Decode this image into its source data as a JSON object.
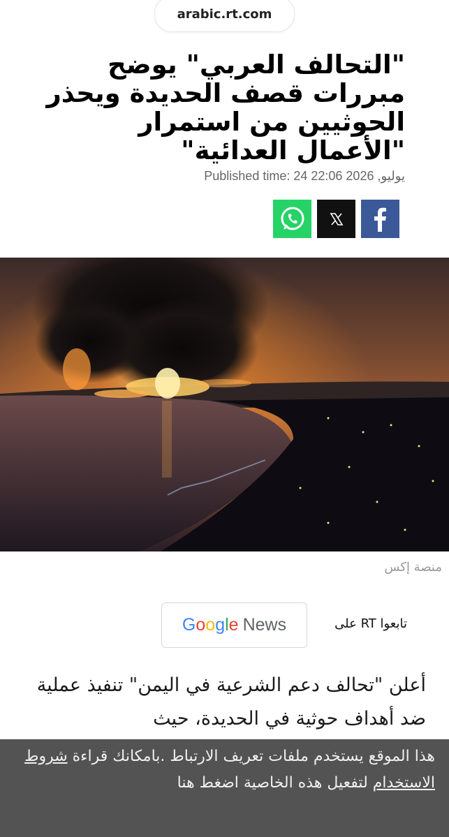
{
  "browser": {
    "url": "arabic.rt.com"
  },
  "article": {
    "headline": "\"التحالف العربي\" يوضح مبررات قصف الحديدة ويحذر الحوثيين من استمرار \"الأعمال العدائية\"",
    "published": "Published time: 24 يوليو, 2026 22:06",
    "image_caption": "منصة إكس",
    "lead": "أعلن \"تحالف دعم الشرعية في اليمن\" تنفيذ عملية ضد أهداف حوثية في الحديدة، حيث"
  },
  "share": {
    "buttons": [
      {
        "name": "facebook",
        "icon": "facebook-icon",
        "color": "#3b5998"
      },
      {
        "name": "x",
        "icon": "x-icon",
        "color": "#111111"
      },
      {
        "name": "whatsapp",
        "icon": "whatsapp-icon",
        "color": "#25d366"
      }
    ]
  },
  "follow": {
    "label": "تابعوا RT على",
    "google_news": {
      "google": "Google",
      "news": "News"
    }
  },
  "cookie_banner": {
    "text_1": "هذا الموقع يستخدم ملفات تعريف الارتباط .بامكانك قراءة",
    "link": "شروط الاستخدام",
    "text_2": "لتفعيل هذه الخاصية اضغط هنا"
  }
}
